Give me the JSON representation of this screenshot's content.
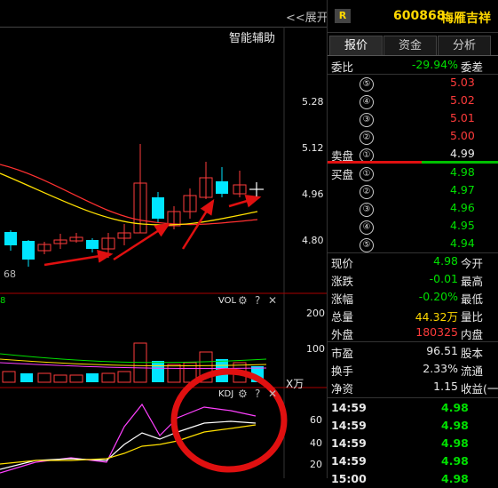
{
  "chart": {
    "expand_label": "<<展开",
    "assist_label": "智能辅助",
    "price_ticks": [
      "5.28",
      "5.12",
      "4.96",
      "4.80"
    ],
    "low_price_label": "68",
    "left_edge_label": "8",
    "vol_label": "VOL",
    "vol_ticks": [
      "200",
      "100"
    ],
    "vol_unit": "X万",
    "kdj_label": "KDJ",
    "kdj_ticks": [
      "60",
      "40",
      "20"
    ],
    "colors": {
      "up": "#ff3b3b",
      "down": "#00e5ff",
      "ma1": "#ffe000",
      "ma2": "#ff3030",
      "kdj_j": "#ff40ff",
      "kdj_k": "#ffffff",
      "kdj_d": "#ffe000"
    }
  },
  "quote": {
    "badge": "R",
    "code": "600868",
    "name": "梅雁吉祥",
    "tabs": [
      "报价",
      "资金",
      "分析"
    ],
    "weibi_label": "委比",
    "weibi_value": "-29.94%",
    "weicha_label": "委差",
    "sell_label": "卖盘",
    "buy_label": "买盘",
    "sells": [
      {
        "num": "⑤",
        "price": "5.03"
      },
      {
        "num": "④",
        "price": "5.02"
      },
      {
        "num": "③",
        "price": "5.01"
      },
      {
        "num": "②",
        "price": "5.00"
      },
      {
        "num": "①",
        "price": "4.99"
      }
    ],
    "buys": [
      {
        "num": "①",
        "price": "4.98"
      },
      {
        "num": "②",
        "price": "4.97"
      },
      {
        "num": "③",
        "price": "4.96"
      },
      {
        "num": "④",
        "price": "4.95"
      },
      {
        "num": "⑤",
        "price": "4.94"
      }
    ],
    "stats": [
      {
        "label": "现价",
        "value": "4.98",
        "label2": "今开"
      },
      {
        "label": "涨跌",
        "value": "-0.01",
        "label2": "最高"
      },
      {
        "label": "涨幅",
        "value": "-0.20%",
        "label2": "最低"
      },
      {
        "label": "总量",
        "value": "44.32万",
        "label2": "量比"
      },
      {
        "label": "外盘",
        "value": "180325",
        "label2": "内盘"
      }
    ],
    "stats2": [
      {
        "label": "市盈",
        "value": "96.51",
        "label2": "股本"
      },
      {
        "label": "换手",
        "value": "2.33%",
        "label2": "流通"
      },
      {
        "label": "净资",
        "value": "1.15",
        "label2": "收益(一"
      }
    ],
    "ticks": [
      {
        "time": "14:59",
        "price": "4.98"
      },
      {
        "time": "14:59",
        "price": "4.98"
      },
      {
        "time": "14:59",
        "price": "4.98"
      },
      {
        "time": "14:59",
        "price": "4.98"
      },
      {
        "time": "15:00",
        "price": "4.98"
      }
    ]
  }
}
